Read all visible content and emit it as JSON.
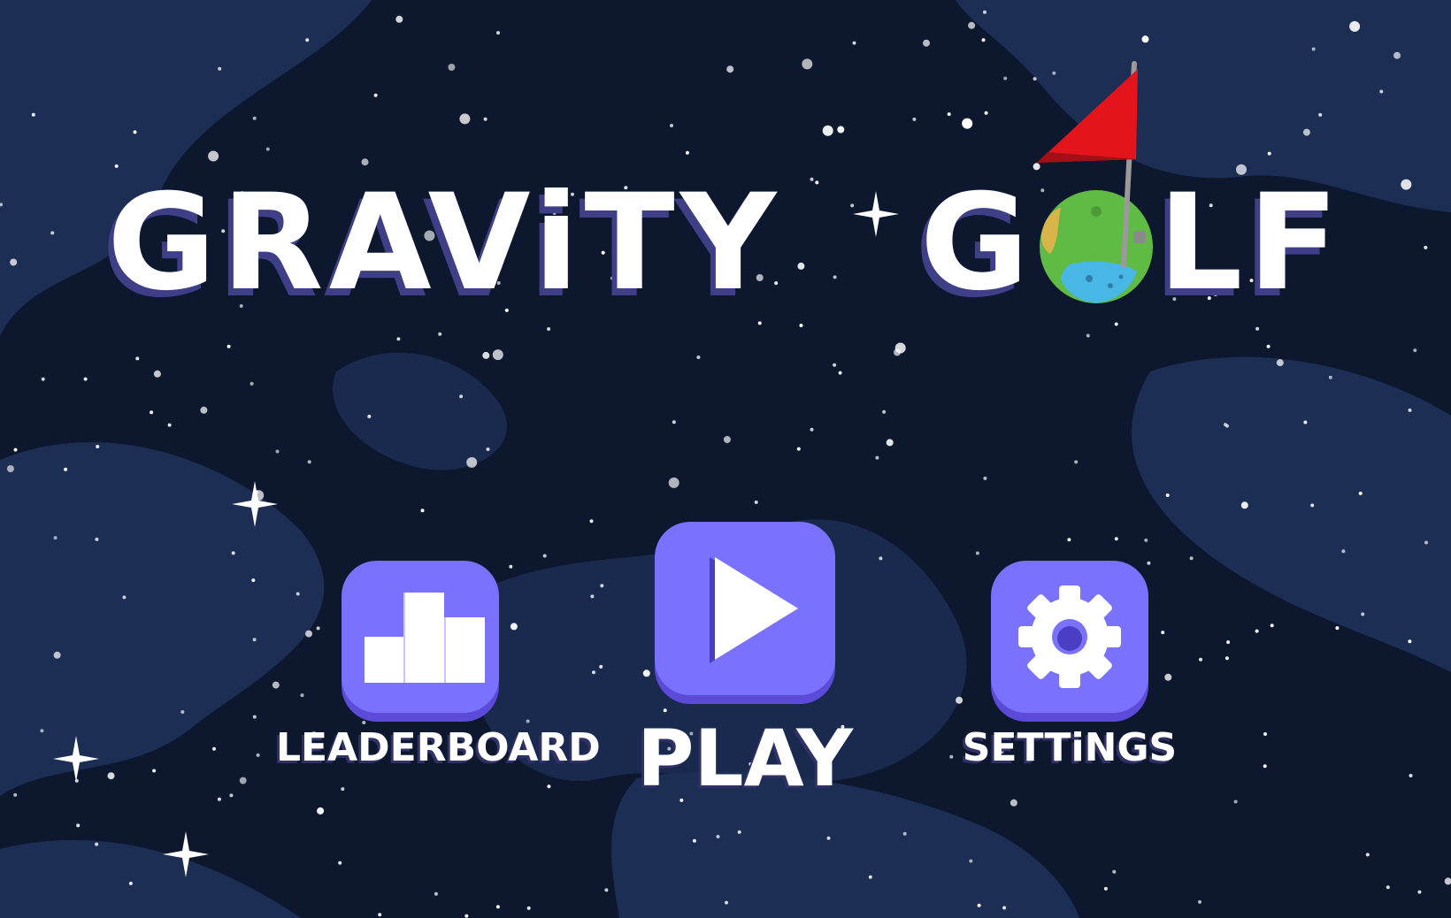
{
  "game": {
    "title_part1": "GRAViTY",
    "title_part2_prefix": "G",
    "title_part2_suffix": "LF"
  },
  "menu": {
    "leaderboard_label": "LEADERBOARD",
    "play_label": "PLAY",
    "settings_label": "SETTiNGS"
  },
  "icons": {
    "leaderboard": "podium-icon",
    "play": "play-icon",
    "settings": "gear-icon",
    "flag": "red-flag-icon",
    "planet": "planet-ball-icon"
  },
  "colors": {
    "background": "#0f1a33",
    "background_swirl": "#1e2f57",
    "button": "#7a71ff",
    "button_shadow": "#5b4bd8",
    "title": "#ffffff",
    "title_shadow": "#3e3f86",
    "flag": "#e3141c",
    "planet": "#67c44a",
    "planet_lake": "#49b7e6"
  }
}
